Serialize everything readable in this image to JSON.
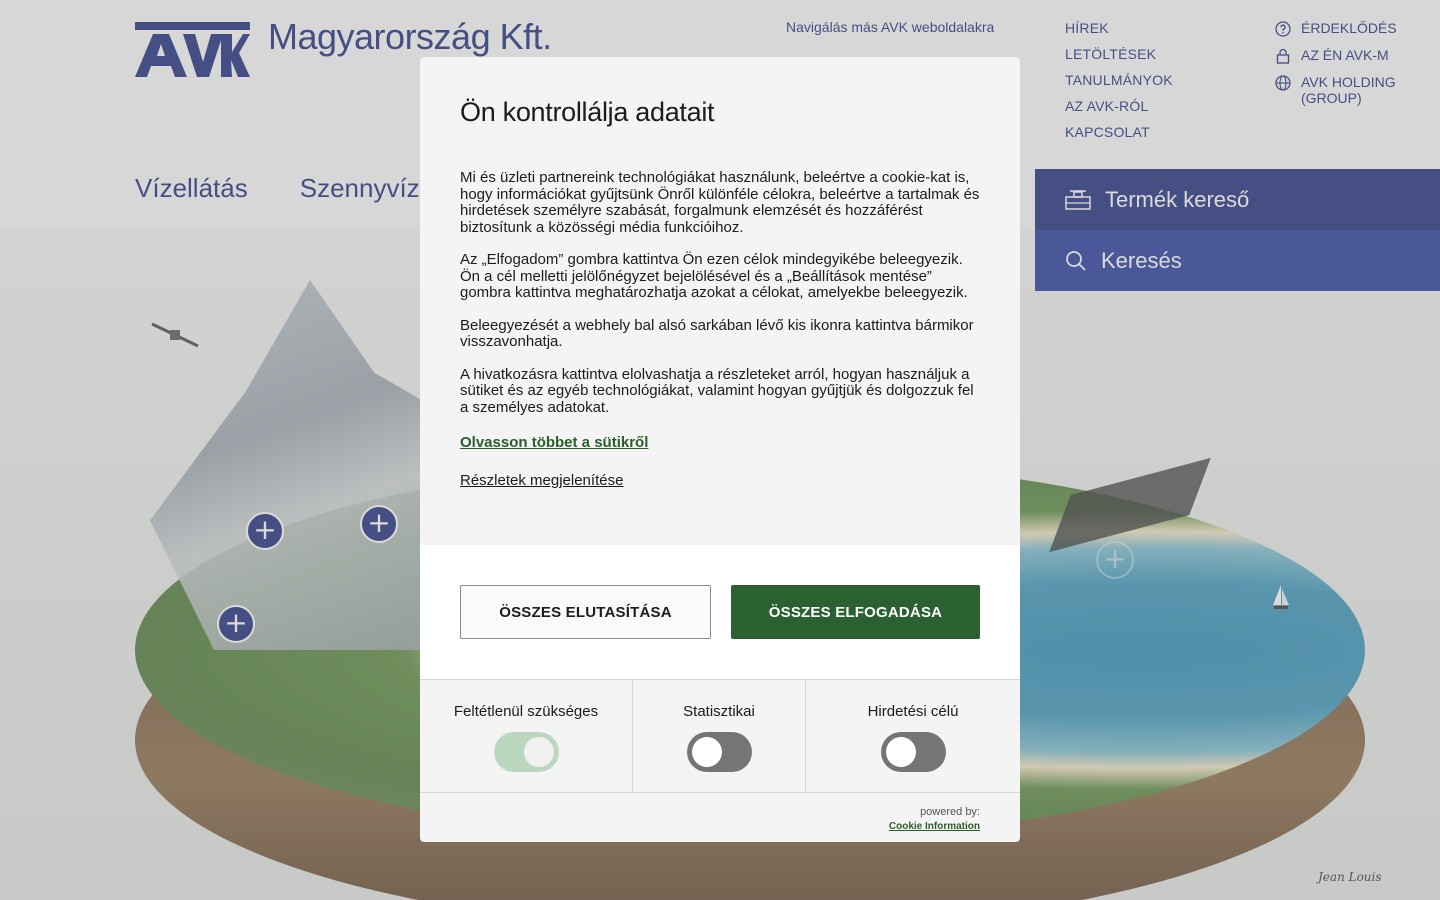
{
  "header": {
    "company": "Magyarország Kft.",
    "nav_other_sites": "Navigálás más AVK weboldalakra"
  },
  "main_nav": [
    "Vízellátás",
    "Szennyvízel"
  ],
  "right_links": [
    "HÍREK",
    "LETÖLTÉSEK",
    "TANULMÁNYOK",
    "AZ AVK-RÓL",
    "KAPCSOLAT"
  ],
  "right_links_icons": [
    {
      "label": "ÉRDEKLŐDÉS",
      "icon": "question-circle-icon"
    },
    {
      "label": "AZ ÉN AVK-M",
      "icon": "lock-icon"
    },
    {
      "label": "AVK HOLDING (GROUP)",
      "icon": "globe-icon"
    }
  ],
  "product_finder": "Termék kereső",
  "search": "Keresés",
  "signature": "Jean Louis",
  "modal": {
    "title": "Ön kontrollálja adatait",
    "paragraphs": [
      "Mi és üzleti partnereink technológiákat használunk, beleértve a cookie-kat is, hogy információkat gyűjtsünk Önről különféle célokra, beleértve a tartalmak és hirdetések személyre szabását, forgalmunk elemzését és hozzáférést biztosítunk a közösségi média funkcióihoz.",
      "Az „Elfogadom” gombra kattintva Ön ezen célok mindegyikébe beleegyezik. Ön a cél melletti jelölőnégyzet bejelölésével és a „Beállítások mentése” gombra kattintva meghatározhatja azokat a célokat, amelyekbe beleegyezik.",
      "Beleegyezését a webhely bal alsó sarkában lévő kis ikonra kattintva bármikor visszavonhatja.",
      "A hivatkozásra kattintva elolvashatja a részleteket arról, hogyan használjuk a sütiket és az egyéb technológiákat, valamint hogyan gyűjtjük és dolgozzuk fel a személyes adatokat."
    ],
    "read_more": "Olvasson többet a sütikről",
    "show_details": "Részletek megjelenítése",
    "reject_all": "ÖSSZES ELUTASÍTÁSA",
    "accept_all": "ÖSSZES ELFOGADÁSA",
    "toggles": [
      {
        "label": "Feltétlenül szükséges",
        "on": true
      },
      {
        "label": "Statisztikai",
        "on": false
      },
      {
        "label": "Hirdetési célú",
        "on": false
      }
    ],
    "powered_by": "powered by:",
    "provider": "Cookie Information"
  },
  "colors": {
    "brand_blue": "#1b2a7a",
    "accept_green": "#2b6130",
    "link_green": "#2b5e2b"
  }
}
